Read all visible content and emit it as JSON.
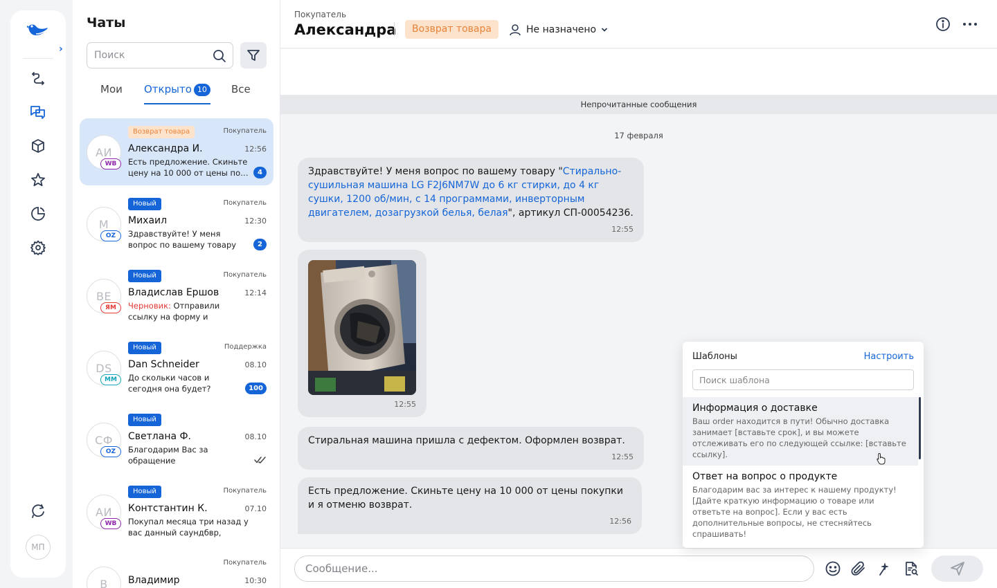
{
  "rail": {
    "avatar_initials": "МП",
    "icons": [
      "logo-bird-icon",
      "routes-icon",
      "chats-icon",
      "box-icon",
      "star-icon",
      "pie-chart-icon",
      "gear-icon",
      "refresh-chat-icon"
    ]
  },
  "list": {
    "title": "Чаты",
    "search_placeholder": "Поиск",
    "tabs": [
      {
        "label": "Мои"
      },
      {
        "label": "Открыто",
        "count": "10"
      },
      {
        "label": "Все"
      }
    ],
    "chats": [
      {
        "initials": "АИ",
        "marketplace": "WB",
        "badge": "Возврат товара",
        "role": "Покупатель",
        "name": "Александра И.",
        "time": "12:56",
        "preview": "Есть предложение. Скиньте цену на 10 000 от цены по…",
        "unread": "4"
      },
      {
        "initials": "М",
        "marketplace": "OZ",
        "badge": "Новый",
        "role": "Покупатель",
        "name": "Михаил",
        "time": "12:30",
        "preview": "Здравствуйте! У меня вопрос по вашему товару \"…",
        "unread": "2"
      },
      {
        "initials": "ВЕ",
        "marketplace": "ЯМ",
        "badge": "Новый",
        "role": "Покупатель",
        "name": "Владислав Ершов",
        "time": "12:14",
        "draft_label": "Черновик:",
        "preview": " Отправили ссылку на форму и дублируем здесь:…"
      },
      {
        "initials": "DS",
        "marketplace": "ММ",
        "badge": "Новый",
        "role": "Поддержка",
        "name": "Dan Schneider",
        "time": "08.10",
        "preview": "До скольки часов и сегодня она будет?",
        "unread": "100"
      },
      {
        "initials": "СФ",
        "marketplace": "OZ",
        "badge": "Новый",
        "role": "",
        "name": "Светлана Ф.",
        "time": "08.10",
        "preview": "Благодарим Вас за обращение"
      },
      {
        "initials": "АИ",
        "marketplace": "WB",
        "badge": "Новый",
        "role": "Покупатель",
        "name": "Контстантин К.",
        "time": "07.10",
        "preview": "Покупал месяца три назад у вас данный саундбвр, появил…"
      },
      {
        "initials": "В",
        "marketplace": "",
        "badge": "",
        "role": "Покупатель",
        "name": "Владимир",
        "time": "10:30",
        "preview": ""
      }
    ]
  },
  "header": {
    "label": "Покупатель",
    "name": "Александра",
    "tag": "Возврат товара",
    "assignee": "Не назначено"
  },
  "chat": {
    "unread_divider": "Непрочитанные сообщения",
    "date": "17 февраля",
    "messages": [
      {
        "prefix": "Здравствуйте! У меня вопрос по вашему товару \"",
        "link": "Стирально-сушильная машина LG F2J6NM7W до 6 кг стирки, до 4 кг сушки, 1200 об/мин, с 14 программами, инверторным двигателем, дозагрузкой белья, белая",
        "suffix": "\", артикул СП-00054236.",
        "time": "12:55"
      },
      {
        "time": "12:55"
      },
      {
        "text": "Стиральная машина пришла с дефектом. Оформлен возврат.",
        "time": "12:55"
      },
      {
        "text": "Есть предложение. Скиньте цену на 10 000 от цены покупки и я отменю возврат.",
        "time": "12:56"
      }
    ]
  },
  "composer": {
    "placeholder": "Сообщение..."
  },
  "templates": {
    "title": "Шаблоны",
    "configure": "Настроить",
    "search_placeholder": "Поиск шаблона",
    "items": [
      {
        "name": "Информация о доставке",
        "text": "Ваш order находится в пути! Обычно доставка занимает [вставьте срок], и вы можете отслеживать его по следующей ссылке: [вставьте ссылку]."
      },
      {
        "name": "Ответ на вопрос о продукте",
        "text": "Благодарим вас за интерес к нашему продукту! [Дайте краткую информацию о товаре или ответьте на вопрос]. Если у вас есть дополнительные вопросы, не стесняйтесь спрашивать!"
      }
    ]
  },
  "colors": {
    "accent": "#1565d8",
    "return_tag_bg": "#fde3cc",
    "return_tag_text": "#e8833a",
    "draft": "#e53935",
    "wb": "#8e24aa",
    "oz": "#1565d8",
    "ym": "#e53935",
    "mm": "#12a3b8"
  }
}
